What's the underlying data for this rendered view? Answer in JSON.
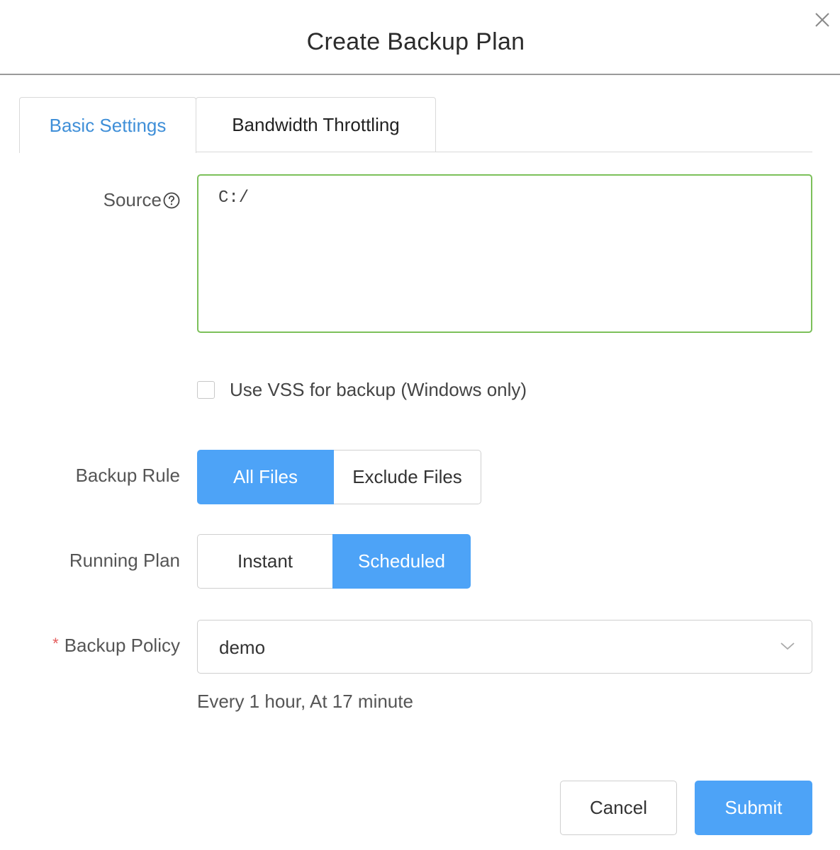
{
  "dialog": {
    "title": "Create Backup Plan"
  },
  "tabs": [
    {
      "label": "Basic Settings",
      "active": true
    },
    {
      "label": "Bandwidth Throttling",
      "active": false
    }
  ],
  "source": {
    "label": "Source",
    "value": "C:/",
    "help_icon": "question-circle-icon"
  },
  "vss": {
    "label": "Use VSS for backup (Windows only)",
    "checked": false
  },
  "backup_rule": {
    "label": "Backup Rule",
    "options": [
      "All Files",
      "Exclude Files"
    ],
    "selected": "All Files"
  },
  "running_plan": {
    "label": "Running Plan",
    "options": [
      "Instant",
      "Scheduled"
    ],
    "selected": "Scheduled"
  },
  "backup_policy": {
    "required_marker": "*",
    "label": "Backup Policy",
    "value": "demo",
    "description": "Every 1 hour, At 17 minute"
  },
  "footer": {
    "cancel_label": "Cancel",
    "submit_label": "Submit"
  },
  "colors": {
    "accent": "#4da3f7",
    "active_tab_text": "#3f8fd8",
    "valid_border": "#7cc05a",
    "required": "#e45b5b"
  }
}
